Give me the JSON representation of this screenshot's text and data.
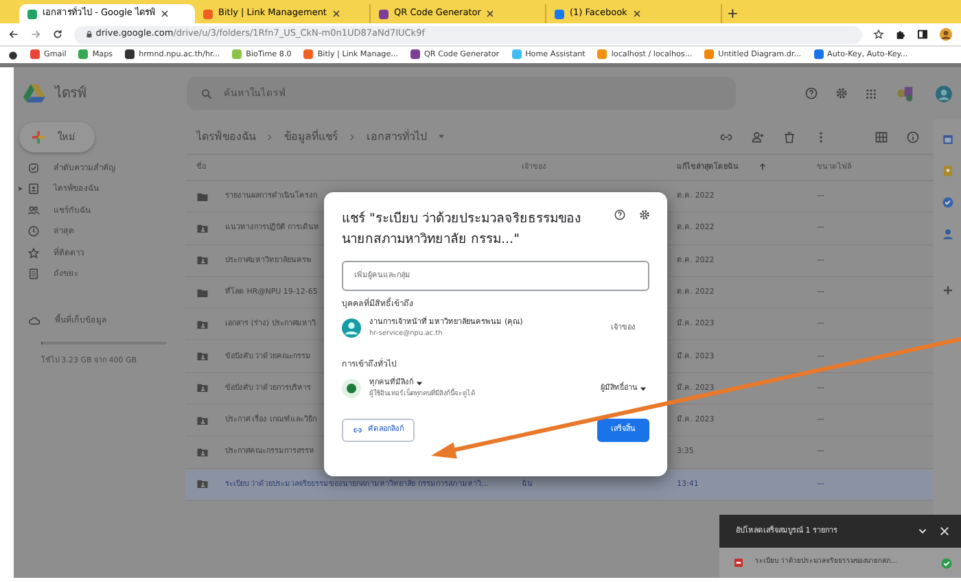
{
  "browser": {
    "tabs": [
      {
        "title": "เอกสารทั่วไป - Google ไดรฟ์",
        "selected": true,
        "color": "#1fa463"
      },
      {
        "title": "Bitly | Link Management",
        "selected": false,
        "color": "#ee6123"
      },
      {
        "title": "QR Code Generator",
        "selected": false,
        "color": "#7b3f98"
      },
      {
        "title": "(1) Facebook",
        "selected": false,
        "color": "#1877f2"
      }
    ],
    "new_tab": "+",
    "address": {
      "host": "drive.google.com",
      "path": "/drive/u/3/folders/1Rfn7_US_CkN-m0n1UD87aNd7IUCk9f"
    },
    "bookmarks": [
      {
        "label": "Gmail",
        "color": "#ea4335"
      },
      {
        "label": "Maps",
        "color": "#34a853"
      },
      {
        "label": "hrmnd.npu.ac.th/hr...",
        "color": "#333333"
      },
      {
        "label": "BioTime 8.0",
        "color": "#8bc34a"
      },
      {
        "label": "Bitly | Link Manage...",
        "color": "#ee6123"
      },
      {
        "label": "QR Code Generator",
        "color": "#7b3f98"
      },
      {
        "label": "Home Assistant",
        "color": "#41bdf5"
      },
      {
        "label": "localhost / localhos...",
        "color": "#f29111"
      },
      {
        "label": "Untitled Diagram.dr...",
        "color": "#f08705"
      },
      {
        "label": "Auto-Key, Auto-Key...",
        "color": "#1a73e8"
      }
    ]
  },
  "drive": {
    "app_name": "ไดรฟ์",
    "search": {
      "placeholder": "ค้นหาในไดรฟ์"
    },
    "new_button": "ใหม่",
    "sidebar": {
      "items": [
        {
          "label": "ลำดับความสำคัญ",
          "expandable": false
        },
        {
          "label": "ไดรฟ์ของฉัน",
          "expandable": true
        },
        {
          "label": "แชร์กับฉัน",
          "expandable": false
        },
        {
          "label": "ล่าสุด",
          "expandable": false
        },
        {
          "label": "ที่ติดดาว",
          "expandable": false
        },
        {
          "label": "ถังขยะ",
          "expandable": false
        }
      ],
      "storage_label": "พื้นที่เก็บข้อมูล",
      "storage": {
        "level": 0.01,
        "text": "ใช้ไป 3.23 GB จาก 400 GB"
      }
    },
    "breadcrumb": [
      "ไดรฟ์ของฉัน",
      "ข้อมูลที่แชร์",
      "เอกสารทั่วไป"
    ],
    "table": {
      "columns": [
        "ชื่อ",
        "เจ้าของ",
        "แก้ไขล่าสุดโดยฉัน",
        "ขนาดไฟล์"
      ],
      "rows": [
        {
          "kind": "folder",
          "name": "รายงานผลการดำเนินโครงก",
          "owner": "",
          "modified": "ต.ค. 2022",
          "size": "—",
          "selected": false
        },
        {
          "kind": "shared-folder",
          "name": "แนวทางการปฏิบัติ การเดินท",
          "modified": "ต.ค. 2022",
          "size": "—",
          "selected": false
        },
        {
          "kind": "shared-folder",
          "name": "ประกาศมหาวิทยาลัยนครพ",
          "modified": "ต.ค. 2022",
          "size": "—",
          "selected": false
        },
        {
          "kind": "folder",
          "name": "ที่โลด HR@NPU 19-12-65",
          "modified": "ต.ค. 2022",
          "size": "—",
          "selected": false
        },
        {
          "kind": "shared-folder",
          "name": "เอกสาร (ร่าง) ประกาศมหาวิ",
          "modified": "มี.ค. 2023",
          "size": "—",
          "selected": false
        },
        {
          "kind": "shared-folder",
          "name": "ข้อบังคับ ว่าด้วยคณะกรรม",
          "modified": "มี.ค. 2023",
          "size": "—",
          "selected": false
        },
        {
          "kind": "shared-folder",
          "name": "ข้อบังคับ ว่าด้วยการบริหาร",
          "modified": "มี.ค. 2023",
          "size": "—",
          "selected": false
        },
        {
          "kind": "shared-folder",
          "name": "ประกาศ เรื่อง เกณฑ์และวิธีก",
          "modified": "มี.ค. 2023",
          "size": "—",
          "selected": false
        },
        {
          "kind": "shared-folder",
          "name": "ประกาศคณะกรรมการสรรห",
          "modified": "3:35",
          "size": "—",
          "selected": false
        },
        {
          "kind": "shared-folder",
          "name": "ระเบียบ ว่าด้วยประมวลจริยธรรมของนายกสภามหาวิทยาลัย กรรมการสภามหาวิ...",
          "owner": "ฉัน",
          "modified": "13:41",
          "size": "—",
          "selected": true
        }
      ]
    }
  },
  "share_dialog": {
    "title": "แชร์ \"ระเบียบ ว่าด้วยประมวลจริยธรรมของนายกสภามหาวิทยาลัย กรรม...\"",
    "input": {
      "placeholder": "เพิ่มผู้คนและกลุ่ม"
    },
    "people_heading": "บุคคลที่มีสิทธิ์เข้าถึง",
    "people": [
      {
        "name": "งานการเจ้าหน้าที่ มหาวิทยาลัยนครพนม (คุณ)",
        "email": "hr-service@npu.ac.th",
        "role": "เจ้าของ"
      }
    ],
    "general_heading": "การเข้าถึงทั่วไป",
    "general_access": {
      "scope": "ทุกคนที่มีลิงก์",
      "description": "ผู้ใช้อินเทอร์เน็ตทุกคนที่มีลิงก์นี้จะดูได้",
      "role": "ผู้มีสิทธิ์อ่าน"
    },
    "copy_link": "คัดลอกลิงก์",
    "done": "เสร็จสิ้น"
  },
  "upload_toast": {
    "title": "อัปโหลดเสร็จสมบูรณ์ 1 รายการ",
    "files": [
      {
        "name": "ระเบียบ ว่าด้วยประมวลจริยธรรมของนายกสภ...",
        "done": true
      }
    ]
  }
}
